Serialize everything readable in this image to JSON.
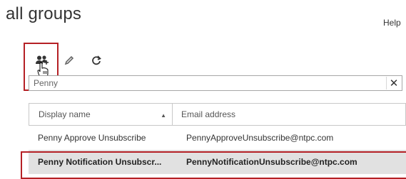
{
  "page": {
    "title": "all groups",
    "help": "Help"
  },
  "toolbar": {
    "add_icon": "add-group-icon",
    "edit_icon": "pencil-icon",
    "refresh_icon": "refresh-icon"
  },
  "search": {
    "value": "Penny",
    "clear_glyph": "✕"
  },
  "grid": {
    "columns": [
      "Display name",
      "Email address"
    ],
    "sort_glyph": "▲",
    "rows": [
      {
        "name": "Penny Approve Unsubscribe",
        "email": "PennyApproveUnsubscribe@ntpc.com",
        "selected": false
      },
      {
        "name": "Penny Notification Unsubscr...",
        "email": "PennyNotificationUnsubscribe@ntpc.com",
        "selected": true
      }
    ]
  },
  "colors": {
    "highlight": "#b52025",
    "selected_row": "#e1e1e1"
  }
}
